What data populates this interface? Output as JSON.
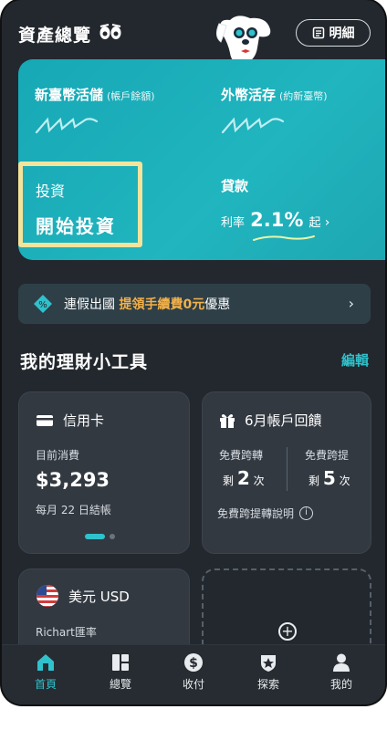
{
  "header": {
    "title": "資產總覽",
    "detail_label": "明細"
  },
  "overview": {
    "twd_deposit": {
      "label": "新臺幣活儲",
      "sub": "(帳戶餘額)"
    },
    "foreign_deposit": {
      "label": "外幣活存",
      "sub": "(約新臺幣)"
    },
    "investment": {
      "label": "投資",
      "action": "開始投資"
    },
    "loan": {
      "label": "貸款",
      "rate_prefix": "利率",
      "rate_value": "2.1%",
      "rate_suffix": "起"
    }
  },
  "promo": {
    "text_before": "連假出國 ",
    "highlight": "提領手續費0元",
    "text_after": "優惠"
  },
  "tools": {
    "title": "我的理財小工具",
    "edit_label": "編輯",
    "credit_card": {
      "title": "信用卡",
      "spend_label": "目前消費",
      "amount": "$3,293",
      "billing": "每月 22 日結帳"
    },
    "rewards": {
      "title": "6月帳戶回饋",
      "transfer_label": "免費跨轉",
      "transfer_prefix": "剩",
      "transfer_count": "2",
      "transfer_unit": "次",
      "withdraw_label": "免費跨提",
      "withdraw_prefix": "剩",
      "withdraw_count": "5",
      "withdraw_unit": "次",
      "info_label": "免費跨提轉說明"
    },
    "fx": {
      "title": "美元 USD",
      "rate_label": "Richart匯率"
    }
  },
  "tabs": [
    {
      "label": "首頁",
      "icon": "home-icon",
      "active": true
    },
    {
      "label": "總覽",
      "icon": "overview-icon",
      "active": false
    },
    {
      "label": "收付",
      "icon": "dollar-icon",
      "active": false
    },
    {
      "label": "探索",
      "icon": "shield-star-icon",
      "active": false
    },
    {
      "label": "我的",
      "icon": "person-icon",
      "active": false
    }
  ],
  "colors": {
    "background": "#23282e",
    "accent": "#2fc2cc",
    "teal_card": "#1fb0bb",
    "highlight_border": "#f4e39b",
    "promo_highlight": "#f3b14a"
  }
}
